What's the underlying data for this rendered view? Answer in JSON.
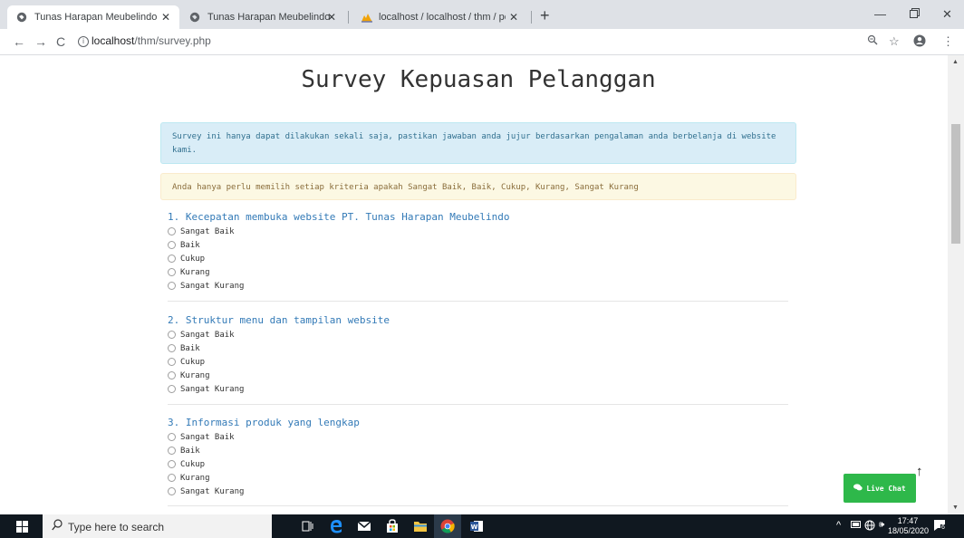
{
  "browser": {
    "tabs": [
      {
        "title": "Tunas Harapan Meubelindo",
        "icon": "globe-icon",
        "active": true
      },
      {
        "title": "Tunas Harapan Meubelindo",
        "icon": "globe-icon",
        "active": false
      },
      {
        "title": "localhost / localhost / thm / pen",
        "icon": "phpmyadmin-icon",
        "active": false
      }
    ],
    "url_host": "localhost",
    "url_path": "/thm/survey.php"
  },
  "page": {
    "title": "Survey Kepuasan Pelanggan",
    "info_alert": "Survey ini hanya dapat dilakukan sekali saja, pastikan jawaban anda jujur berdasarkan pengalaman anda berbelanja di website kami.",
    "warning_alert": "Anda hanya perlu memilih setiap kriteria apakah Sangat Baik, Baik, Cukup, Kurang, Sangat Kurang",
    "options": [
      "Sangat Baik",
      "Baik",
      "Cukup",
      "Kurang",
      "Sangat Kurang"
    ],
    "questions": [
      {
        "title": "1. Kecepatan membuka website PT. Tunas Harapan Meubelindo"
      },
      {
        "title": "2. Struktur menu dan tampilan website"
      },
      {
        "title": "3. Informasi produk yang lengkap"
      }
    ],
    "live_chat_label": "Live Chat"
  },
  "taskbar": {
    "search_placeholder": "Type here to search",
    "time": "17:47",
    "date": "18/05/2020",
    "notification_count": "6"
  },
  "colors": {
    "link_blue": "#337ab7",
    "info_bg": "#d9edf7",
    "warning_bg": "#fcf8e3",
    "live_chat_green": "#2eb84a"
  }
}
